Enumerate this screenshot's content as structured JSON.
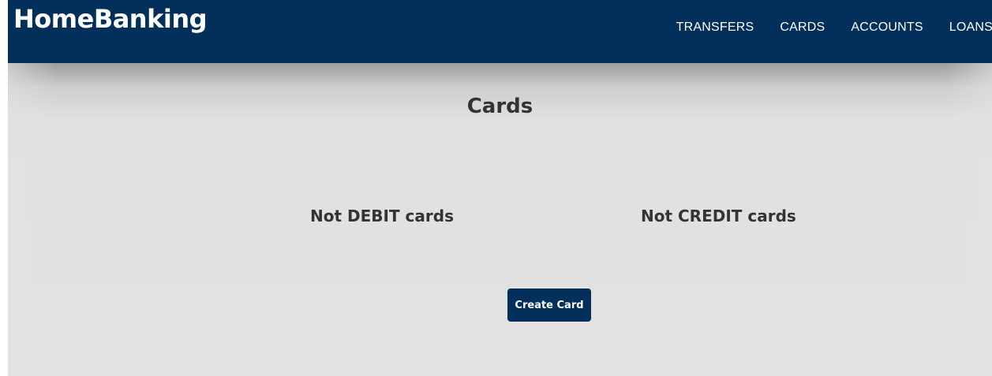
{
  "header": {
    "brand": "HomeBanking",
    "nav": [
      {
        "label": "TRANSFERS"
      },
      {
        "label": "CARDS"
      },
      {
        "label": "ACCOUNTS"
      },
      {
        "label": "LOANS"
      }
    ]
  },
  "main": {
    "title": "Cards",
    "debit_empty_text": "Not DEBIT cards",
    "credit_empty_text": "Not CREDIT cards",
    "create_button_label": "Create Card"
  },
  "colors": {
    "navbar": "#02305a",
    "content_background": "#e4e2e1",
    "text": "#333333",
    "button": "#02305a"
  }
}
